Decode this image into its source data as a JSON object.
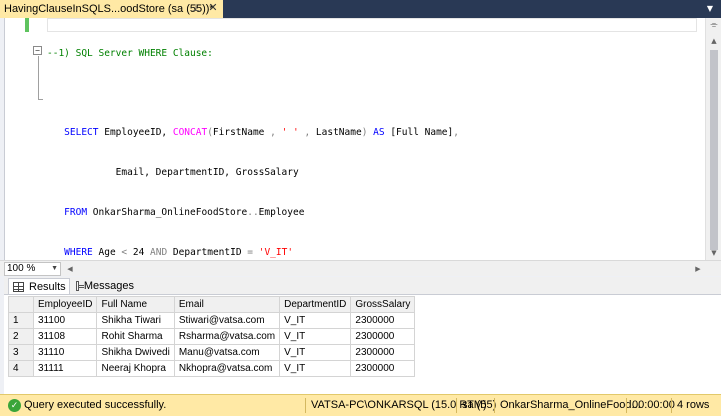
{
  "tab": {
    "title": "HavingClauseInSQLS...oodStore (sa (55))*",
    "pin_glyph": "⊥",
    "close_glyph": "✕",
    "dropdown_glyph": "▼"
  },
  "editor": {
    "comment_line": "--1) SQL Server WHERE Clause:",
    "select_kw": "SELECT",
    "select_cols_a": " EmployeeID, ",
    "concat_fn": "CONCAT",
    "concat_open": "(",
    "concat_firstname": "FirstName ",
    "comma1": ", ",
    "space_str": "' '",
    "comma2": " , ",
    "concat_lastname": "LastName",
    "concat_close": ")",
    "as_kw": " AS ",
    "alias": "[Full Name]",
    "comma3": ",",
    "line2_indent": "            ",
    "line2_cols": "Email, DepartmentID, GrossSalary",
    "from_kw": "FROM",
    "from_table": " OnkarSharma_OnlineFoodStore",
    "from_dots": "..",
    "from_table2": "Employee",
    "where_kw": "WHERE",
    "where_age": " Age ",
    "lt_op": "<",
    "where_num": " 24 ",
    "and_kw": "AND",
    "where_dept": " DepartmentID ",
    "eq_op": "=",
    "dept_val": "'V_IT'",
    "collapse_glyph": "−"
  },
  "zoom": {
    "value": "100 %",
    "dropdown_glyph": "▼"
  },
  "scroll_glyphs": {
    "up": "▲",
    "down": "▼",
    "left": "◀",
    "right": "▶",
    "split": "⌯"
  },
  "results_tabs": {
    "results_label": "Results",
    "messages_label": "Messages"
  },
  "results": {
    "columns": [
      "EmployeeID",
      "Full Name",
      "Email",
      "DepartmentID",
      "GrossSalary"
    ],
    "rows": [
      {
        "num": "1",
        "cells": [
          "31100",
          "Shikha Tiwari",
          "Stiwari@vatsa.com",
          "V_IT",
          "2300000"
        ]
      },
      {
        "num": "2",
        "cells": [
          "31108",
          "Rohit Sharma",
          "Rsharma@vatsa.com",
          "V_IT",
          "2300000"
        ]
      },
      {
        "num": "3",
        "cells": [
          "31110",
          "Shikha Dwivedi",
          "Manu@vatsa.com",
          "V_IT",
          "2300000"
        ]
      },
      {
        "num": "4",
        "cells": [
          "31111",
          "Neeraj Khopra",
          "Nkhopra@vatsa.com",
          "V_IT",
          "2300000"
        ]
      }
    ]
  },
  "status": {
    "ok_glyph": "✓",
    "message": "Query executed successfully.",
    "server": "VATSA-PC\\ONKARSQL (15.0 RTM)",
    "user": "sa (55)",
    "database": "OnkarSharma_OnlineFood...",
    "elapsed": "00:00:00",
    "rows": "4 rows"
  },
  "colors": {
    "tab_active": "#ffe9a5",
    "tabstrip_bg": "#293955",
    "status_bg": "#ffe9a5",
    "keyword": "#0000ff",
    "comment": "#008000",
    "function": "#ff00ff",
    "string": "#ff0000"
  }
}
